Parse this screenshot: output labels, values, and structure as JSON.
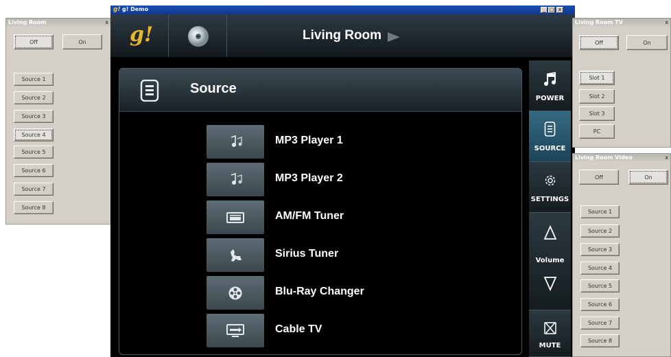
{
  "left_window": {
    "title": "Living Room",
    "close": "x",
    "power": [
      "Off",
      "On"
    ],
    "sources": [
      "Source 1",
      "Source 2",
      "Source 3",
      "Source 4",
      "Source 5",
      "Source 6",
      "Source 7",
      "Source 8"
    ]
  },
  "main_window": {
    "title": "g! Demo",
    "caption_buttons": [
      "_",
      "□",
      "x"
    ],
    "header": {
      "room": "Living Room",
      "logo": "g!"
    },
    "panel": {
      "title": "Source",
      "items": [
        {
          "label": "MP3 Player 1",
          "icon": "music-notes-icon"
        },
        {
          "label": "MP3 Player 2",
          "icon": "music-notes-icon"
        },
        {
          "label": "AM/FM Tuner",
          "icon": "radio-icon"
        },
        {
          "label": "Sirius Tuner",
          "icon": "dog-icon"
        },
        {
          "label": "Blu-Ray Changer",
          "icon": "film-reel-icon"
        },
        {
          "label": "Cable TV",
          "icon": "tv-icon"
        }
      ]
    },
    "nav": {
      "power": "POWER",
      "source": "SOURCE",
      "settings": "SETTINGS",
      "volume": "Volume",
      "mute": "MUTE"
    }
  },
  "tv_window": {
    "title": "Living Room TV",
    "close": "x",
    "power": [
      "Off",
      "On"
    ],
    "slots": [
      "Slot 1",
      "Slot 2",
      "Slot 3",
      "PC"
    ]
  },
  "video_window": {
    "title": "Living Room Video",
    "close": "x",
    "power": [
      "Off",
      "On"
    ],
    "sources": [
      "Source 1",
      "Source 2",
      "Source 3",
      "Source 4",
      "Source 5",
      "Source 6",
      "Source 7",
      "Source 8"
    ]
  },
  "colors": {
    "accent": "#356a84",
    "title_bar": "#1a4fb5",
    "logo": "#f3c437"
  }
}
